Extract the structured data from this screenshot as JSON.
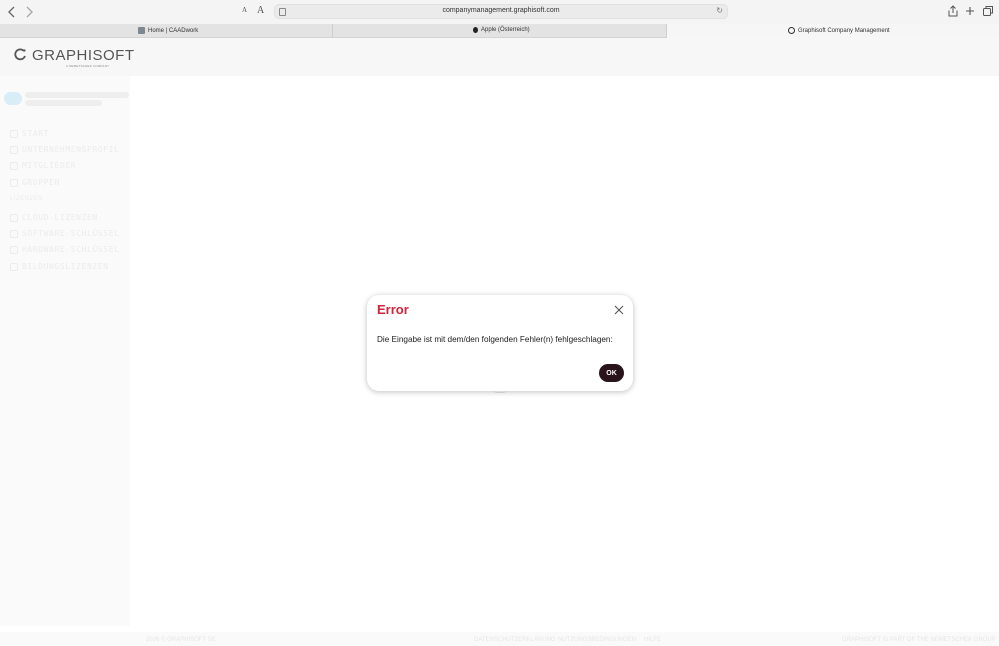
{
  "browser": {
    "url": "companymanagement.graphisoft.com",
    "reader_small": "A",
    "reader_large": "A",
    "tabs": [
      {
        "label": "Home | CAADwork",
        "active": false
      },
      {
        "label": "Apple (Österreich)",
        "active": false
      },
      {
        "label": "Graphisoft Company Management",
        "active": true
      }
    ]
  },
  "header": {
    "logo_text": "GRAPHISOFT",
    "logo_subtext": "A NEMETSCHEK COMPANY"
  },
  "sidebar": {
    "items_top": [
      "START",
      "UNTERNEHMENSPROFIL",
      "MITGLIEDER",
      "GRUPPEN"
    ],
    "section_label": "LIZENZEN",
    "items_bottom": [
      "CLOUD-LIZENZEN",
      "SOFTWARE-SCHLÜSSEL",
      "HARDWARE-SCHLÜSSEL",
      "BILDUNGSLIZENZEN"
    ]
  },
  "footer": {
    "left": "2026 © GRAPHISOFT SE",
    "middle_1": "DATENSCHUTZERKLÄRUNG",
    "middle_2": "NUTZUNGSBEDINGUNGEN",
    "middle_3": "HILFE",
    "right": "GRAPHISOFT IS PART OF THE NEMETSCHEK GROUP"
  },
  "dialog": {
    "title": "Error",
    "message": "Die Eingabe ist mit dem/den folgenden Fehler(n) fehlgeschlagen:",
    "ok_label": "OK"
  },
  "colors": {
    "error_title": "#d0253a",
    "ok_button": "#2a141c"
  }
}
